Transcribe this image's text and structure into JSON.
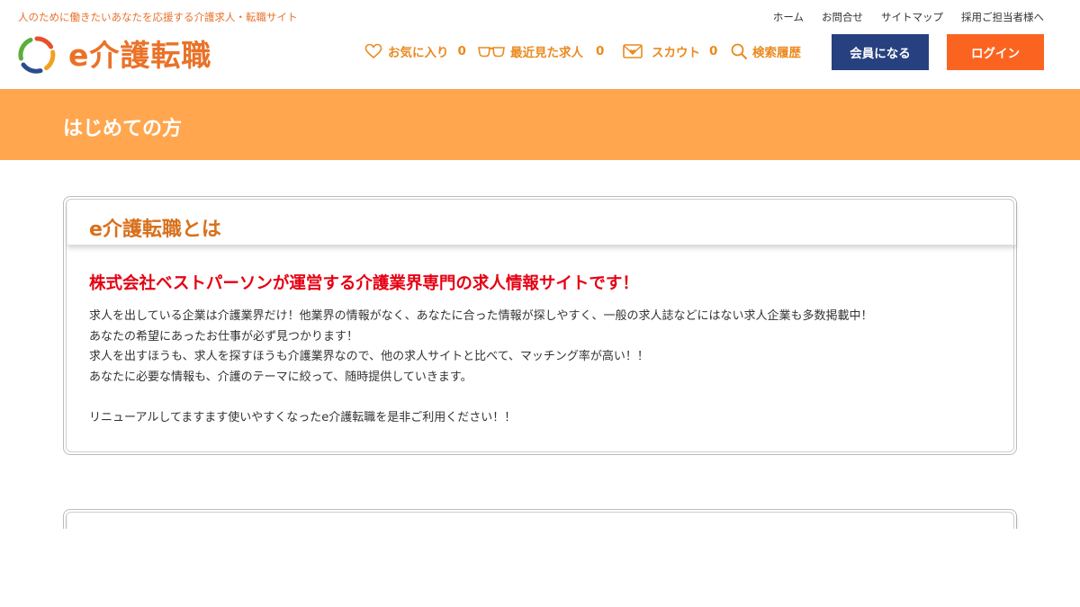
{
  "header": {
    "tagline": "人のために働きたいあなたを応援する介護求人・転職サイト",
    "logo_text": "e介護転職",
    "util_nav": [
      "ホーム",
      "お問合せ",
      "サイトマップ",
      "採用ご担当者様へ"
    ],
    "nav": {
      "favorites": {
        "label": "お気に入り",
        "count": "0"
      },
      "recent": {
        "label": "最近見た求人",
        "count": "0"
      },
      "scout": {
        "label": "スカウト",
        "count": "0"
      },
      "history": {
        "label": "検索履歴"
      }
    },
    "register_label": "会員になる",
    "login_label": "ログイン"
  },
  "banner": {
    "title": "はじめての方"
  },
  "section1": {
    "heading": "e介護転職とは",
    "lead": "株式会社ベストパーソンが運営する介護業界専門の求人情報サイトです！",
    "paragraphs": [
      "求人を出している企業は介護業界だけ！他業界の情報がなく、あなたに合った情報が探しやすく、一般の求人誌などにはない求人企業も多数掲載中！",
      "あなたの希望にあったお仕事が必ず見つかります！",
      "求人を出すほうも、求人を探すほうも介護業界なので、他の求人サイトと比べて、マッチング率が高い！！",
      "あなたに必要な情報も、介護のテーマに絞って、随時提供していきます。",
      "リニューアルしてますます使いやすくなったe介護転職を是非ご利用ください！！"
    ]
  },
  "colors": {
    "accent_orange": "#ea7228",
    "banner": "#ffa64f",
    "register_button": "#27407f",
    "login_button": "#fb6420",
    "lead_red": "#e60012"
  }
}
